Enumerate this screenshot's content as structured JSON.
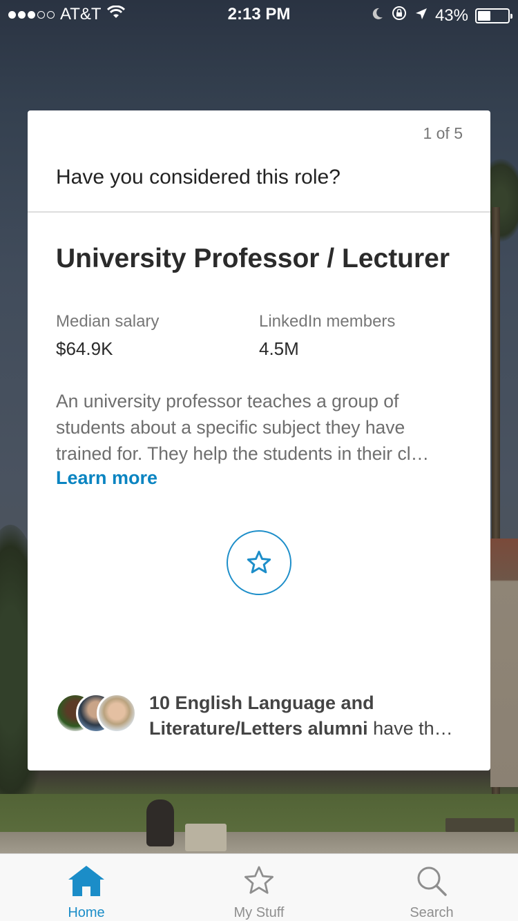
{
  "status_bar": {
    "carrier": "AT&T",
    "time": "2:13 PM",
    "battery": "43%",
    "battery_level": 0.43
  },
  "card": {
    "counter": "1 of 5",
    "prompt": "Have you considered this role?",
    "role_title": "University Professor / Lecturer",
    "stats": {
      "salary_label": "Median salary",
      "salary_value": "$64.9K",
      "members_label": "LinkedIn members",
      "members_value": "4.5M"
    },
    "description_lines": [
      "An university professor teaches a group of",
      "students about a specific subject they have",
      "trained for. They help the students in their cl…"
    ],
    "learn_more": "Learn more",
    "alumni": {
      "bold_line1": "10 English Language and",
      "bold_line2": "Literature/Letters alumni",
      "rest": " have th…"
    }
  },
  "tabs": [
    {
      "label": "Home",
      "icon": "home-icon",
      "active": true
    },
    {
      "label": "My Stuff",
      "icon": "star-icon",
      "active": false
    },
    {
      "label": "Search",
      "icon": "search-icon",
      "active": false
    }
  ],
  "colors": {
    "accent": "#0a84c1",
    "tab_active": "#1b8dc8",
    "tab_inactive": "#8e8e8e"
  }
}
